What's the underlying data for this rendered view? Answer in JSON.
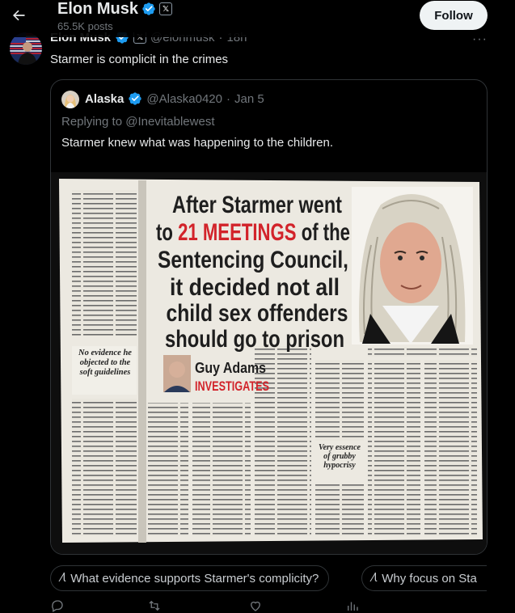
{
  "header": {
    "name": "Elon Musk",
    "posts": "65.5K posts",
    "follow_label": "Follow"
  },
  "post": {
    "author_name": "Elon Musk",
    "handle": "@elonmusk",
    "time": "18h",
    "text": "Starmer is complicit in the crimes",
    "more": "···"
  },
  "quote": {
    "author_name": "Alaska",
    "handle": "@Alaska0420",
    "time": "Jan 5",
    "replying_to": "Replying to @Inevitablewest",
    "text": "Starmer knew what was happening to the children."
  },
  "clipping": {
    "headline_1": "After Starmer went",
    "headline_2a": "to ",
    "headline_2b": "21 MEETINGS",
    "headline_2c": " of the",
    "headline_3": "Sentencing Council,",
    "headline_4": "it decided not all",
    "headline_5": "child sex offenders",
    "headline_6": "should go to prison",
    "byline_name": "Guy Adams",
    "byline_tag": "INVESTIGATES",
    "pullquote_left": "No evidence he objected to the soft guidelines",
    "pullquote_mid": "Very essence of grubby hypocrisy"
  },
  "chips": [
    {
      "label": "What evidence supports Starmer's complicity?"
    },
    {
      "label": "Why focus on Sta"
    }
  ],
  "actions": {
    "replies": "",
    "reposts": "",
    "likes": "",
    "views": ""
  },
  "colors": {
    "background": "#000000",
    "text_primary": "#e7e9ea",
    "text_secondary": "#71767b",
    "verified_blue": "#1d9bf0",
    "border": "#2f3336",
    "clip_red": "#d2232a"
  },
  "icons": [
    "back-arrow-icon",
    "verified-badge-icon",
    "x-affiliation-icon",
    "more-icon",
    "grok-icon",
    "reply-icon",
    "repost-icon",
    "like-icon",
    "views-icon"
  ]
}
